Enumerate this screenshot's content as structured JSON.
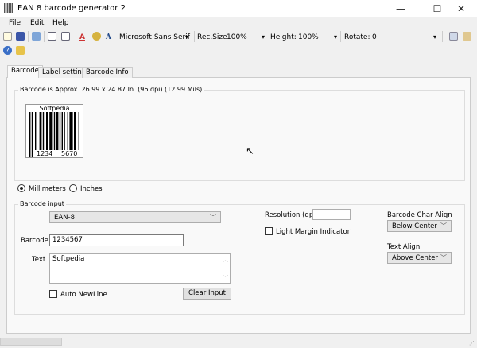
{
  "window": {
    "title": "EAN 8 barcode generator 2",
    "minimize": "—",
    "maximize": "☐",
    "close": "✕"
  },
  "menu": [
    "File",
    "Edit",
    "Help"
  ],
  "toolbar": {
    "font_name": "Microsoft Sans Serif",
    "rec_size_label": "Rec.Size",
    "rec_size_value": "100%",
    "height_label": "Height:",
    "height_value": "100%",
    "rotate_label": "Rotate:",
    "rotate_value": "0",
    "font_color_glyph": "A",
    "font_glyph": "A"
  },
  "tabs": [
    "Barcode",
    "Label settings",
    "Barcode Info"
  ],
  "barcode_tab": {
    "info": "Barcode is Approx. 26.99 x 24.87 In.  (96 dpi) (12.99 Mils)",
    "preview": {
      "top_text": "Softpedia",
      "left_digits": "1234",
      "right_digits": "5670"
    },
    "units": [
      "Millimeters",
      "Inches"
    ],
    "selected_unit": "Millimeters",
    "input_group": "Barcode input",
    "symbology": "EAN-8",
    "barcode_label": "Barcode",
    "barcode_value": "1234567",
    "text_label": "Text",
    "text_value": "Softpedia",
    "auto_newline": "Auto NewLine",
    "clear_input": "Clear Input",
    "resolution_label": "Resolution (dpi)",
    "resolution_value": "",
    "light_margin": "Light Margin Indicator",
    "char_align_label": "Barcode Char Align",
    "char_align_value": "Below Center",
    "text_align_label": "Text Align",
    "text_align_value": "Above Center"
  }
}
